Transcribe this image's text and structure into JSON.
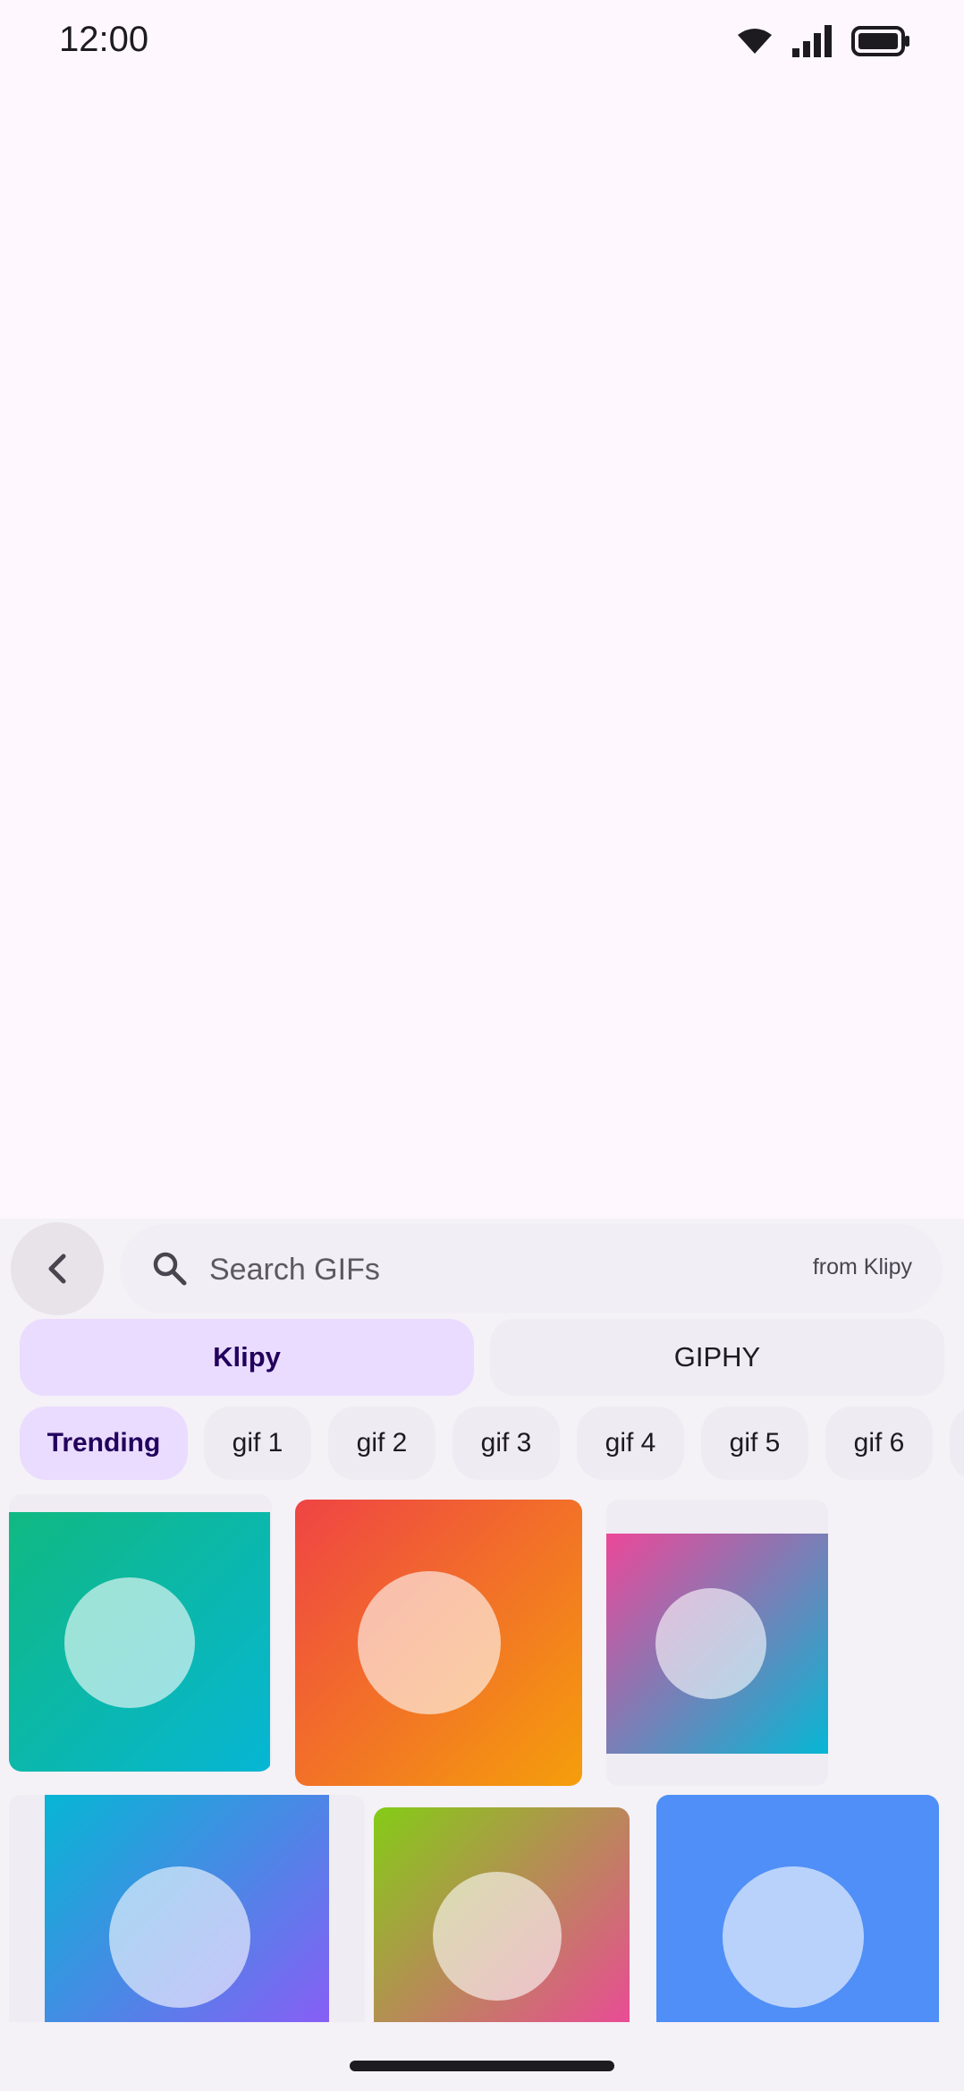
{
  "status_bar": {
    "time": "12:00",
    "icons": [
      "wifi-icon",
      "signal-icon",
      "battery-icon"
    ]
  },
  "picker": {
    "back_icon": "chevron-left-icon",
    "search": {
      "placeholder": "Search GIFs",
      "value": "",
      "icon": "search-icon",
      "source_label": "from Klipy"
    },
    "providers": [
      {
        "label": "Klipy",
        "selected": true
      },
      {
        "label": "GIPHY",
        "selected": false
      }
    ],
    "categories": [
      {
        "label": "Trending",
        "selected": true
      },
      {
        "label": "gif 1",
        "selected": false
      },
      {
        "label": "gif 2",
        "selected": false
      },
      {
        "label": "gif 3",
        "selected": false
      },
      {
        "label": "gif 4",
        "selected": false
      },
      {
        "label": "gif 5",
        "selected": false
      },
      {
        "label": "gif 6",
        "selected": false
      }
    ],
    "gifs": [
      {
        "colors": [
          "#10b981",
          "#06b6d4"
        ]
      },
      {
        "colors": [
          "#ef4444",
          "#f59e0b"
        ]
      },
      {
        "colors": [
          "#ec4899",
          "#06b6d4"
        ]
      },
      {
        "colors": [
          "#06b6d4",
          "#8b5cf6"
        ]
      },
      {
        "colors": [
          "#84cc16",
          "#ec4899"
        ]
      },
      {
        "colors": [
          "#4f8ff7",
          "#4f8ff7"
        ]
      }
    ]
  },
  "colors": {
    "background": "#fef7fe",
    "panel": "#f4f1f7",
    "selected": "#eadcfe",
    "selected_text": "#22005d",
    "text": "#1d1b20"
  }
}
